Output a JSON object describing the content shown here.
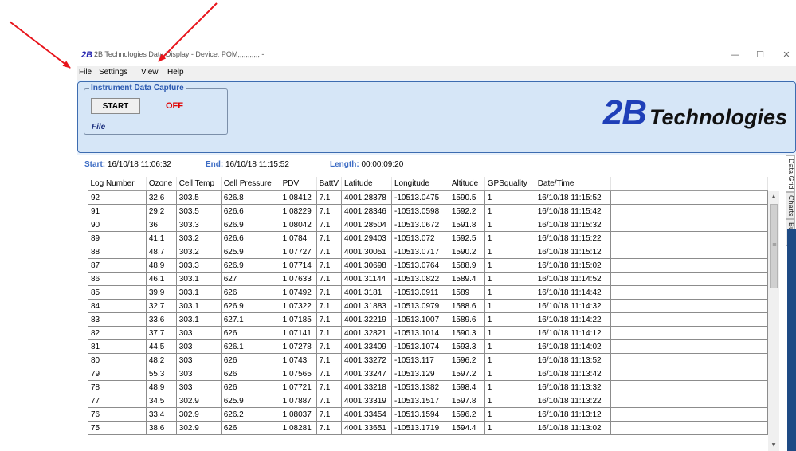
{
  "window": {
    "app_logo": "2B",
    "title": "2B Technologies Data Display - Device: POM,,,,,,,,,,, -",
    "controls": {
      "minimize": "—",
      "maximize": "☐",
      "close": "✕"
    }
  },
  "menubar": {
    "items": [
      "File",
      "Settings",
      "View",
      "Help"
    ]
  },
  "capture": {
    "group_label": "Instrument Data Capture",
    "start_button": "START",
    "status": "OFF",
    "source": "File"
  },
  "brand": {
    "logo": "2B",
    "name": "Technologies"
  },
  "summary": {
    "start_label": "Start:",
    "start_value": "16/10/18 11:06:32",
    "end_label": "End:",
    "end_value": "16/10/18 11:15:52",
    "length_label": "Length:",
    "length_value": "00:00:09:20"
  },
  "table": {
    "columns": [
      "Log Number",
      "Ozone",
      "Cell Temp",
      "Cell Pressure",
      "PDV",
      "BattV",
      "Latitude",
      "Longitude",
      "Altitude",
      "GPSquality",
      "Date/Time"
    ],
    "rows": [
      [
        "92",
        "32.6",
        "303.5",
        "626.8",
        "1.08412",
        "7.1",
        "4001.28378",
        "-10513.0475",
        "1590.5",
        "1",
        "16/10/18 11:15:52"
      ],
      [
        "91",
        "29.2",
        "303.5",
        "626.6",
        "1.08229",
        "7.1",
        "4001.28346",
        "-10513.0598",
        "1592.2",
        "1",
        "16/10/18 11:15:42"
      ],
      [
        "90",
        "36",
        "303.3",
        "626.9",
        "1.08042",
        "7.1",
        "4001.28504",
        "-10513.0672",
        "1591.8",
        "1",
        "16/10/18 11:15:32"
      ],
      [
        "89",
        "41.1",
        "303.2",
        "626.6",
        "1.0784",
        "7.1",
        "4001.29403",
        "-10513.072",
        "1592.5",
        "1",
        "16/10/18 11:15:22"
      ],
      [
        "88",
        "48.7",
        "303.2",
        "625.9",
        "1.07727",
        "7.1",
        "4001.30051",
        "-10513.0717",
        "1590.2",
        "1",
        "16/10/18 11:15:12"
      ],
      [
        "87",
        "48.9",
        "303.3",
        "626.9",
        "1.07714",
        "7.1",
        "4001.30698",
        "-10513.0764",
        "1588.9",
        "1",
        "16/10/18 11:15:02"
      ],
      [
        "86",
        "46.1",
        "303.1",
        "627",
        "1.07633",
        "7.1",
        "4001.31144",
        "-10513.0822",
        "1589.4",
        "1",
        "16/10/18 11:14:52"
      ],
      [
        "85",
        "39.9",
        "303.1",
        "626",
        "1.07492",
        "7.1",
        "4001.3181",
        "-10513.0911",
        "1589",
        "1",
        "16/10/18 11:14:42"
      ],
      [
        "84",
        "32.7",
        "303.1",
        "626.9",
        "1.07322",
        "7.1",
        "4001.31883",
        "-10513.0979",
        "1588.6",
        "1",
        "16/10/18 11:14:32"
      ],
      [
        "83",
        "33.6",
        "303.1",
        "627.1",
        "1.07185",
        "7.1",
        "4001.32219",
        "-10513.1007",
        "1589.6",
        "1",
        "16/10/18 11:14:22"
      ],
      [
        "82",
        "37.7",
        "303",
        "626",
        "1.07141",
        "7.1",
        "4001.32821",
        "-10513.1014",
        "1590.3",
        "1",
        "16/10/18 11:14:12"
      ],
      [
        "81",
        "44.5",
        "303",
        "626.1",
        "1.07278",
        "7.1",
        "4001.33409",
        "-10513.1074",
        "1593.3",
        "1",
        "16/10/18 11:14:02"
      ],
      [
        "80",
        "48.2",
        "303",
        "626",
        "1.0743",
        "7.1",
        "4001.33272",
        "-10513.117",
        "1596.2",
        "1",
        "16/10/18 11:13:52"
      ],
      [
        "79",
        "55.3",
        "303",
        "626",
        "1.07565",
        "7.1",
        "4001.33247",
        "-10513.129",
        "1597.2",
        "1",
        "16/10/18 11:13:42"
      ],
      [
        "78",
        "48.9",
        "303",
        "626",
        "1.07721",
        "7.1",
        "4001.33218",
        "-10513.1382",
        "1598.4",
        "1",
        "16/10/18 11:13:32"
      ],
      [
        "77",
        "34.5",
        "302.9",
        "625.9",
        "1.07887",
        "7.1",
        "4001.33319",
        "-10513.1517",
        "1597.8",
        "1",
        "16/10/18 11:13:22"
      ],
      [
        "76",
        "33.4",
        "302.9",
        "626.2",
        "1.08037",
        "7.1",
        "4001.33454",
        "-10513.1594",
        "1596.2",
        "1",
        "16/10/18 11:13:12"
      ],
      [
        "75",
        "38.6",
        "302.9",
        "626",
        "1.08281",
        "7.1",
        "4001.33651",
        "-10513.1719",
        "1594.4",
        "1",
        "16/10/18 11:13:02"
      ]
    ]
  },
  "scrollbar": {
    "up": "▲",
    "down": "▼",
    "grip": "≡"
  },
  "side_tabs": [
    "Data Grid",
    "Charts",
    "Buffer"
  ],
  "annotation": {
    "arrow_color": "#e8141b"
  }
}
